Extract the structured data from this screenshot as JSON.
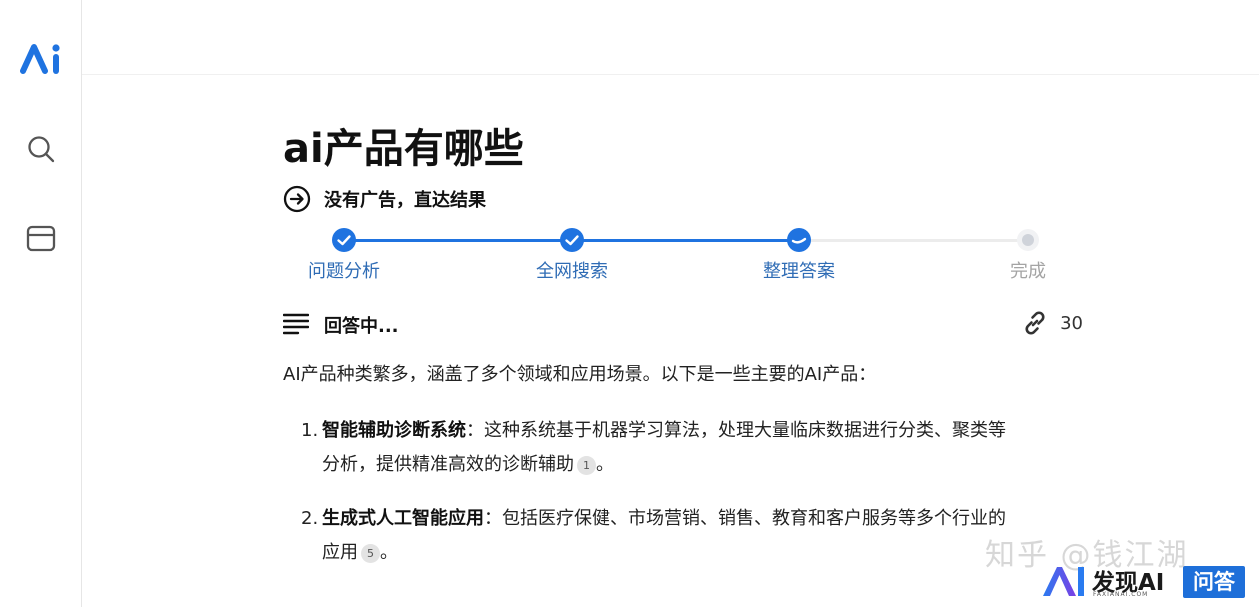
{
  "query": {
    "title": "ai产品有哪些"
  },
  "banner": {
    "text": "没有广告，直达结果"
  },
  "steps": [
    {
      "label": "问题分析",
      "state": "done"
    },
    {
      "label": "全网搜索",
      "state": "done"
    },
    {
      "label": "整理答案",
      "state": "active"
    },
    {
      "label": "完成",
      "state": "pending"
    }
  ],
  "answer": {
    "status": "回答中...",
    "source_count": "30",
    "intro": "AI产品种类繁多，涵盖了多个领域和应用场景。以下是一些主要的AI产品：",
    "items": [
      {
        "number": "1.",
        "heading": "智能辅助诊断系统",
        "text": "：这种系统基于机器学习算法，处理大量临床数据进行分类、聚类等",
        "text_line2": "分析，提供精准高效的诊断辅助",
        "citation": "1",
        "end": "。"
      },
      {
        "number": "2.",
        "heading": "生成式人工智能应用",
        "text": "：包括医疗保健、市场营销、销售、教育和客户服务等多个行业的",
        "text_line2": "应用",
        "citation": "5",
        "end": "。"
      }
    ]
  },
  "watermark": {
    "zhihu": "知乎 @钱江湖",
    "brand_name": "发现AI",
    "brand_domain": "FAXIANAI.COM",
    "brand_badge": "问答"
  },
  "colors": {
    "accent": "#1f73e0",
    "step_label": "#2f6cb5",
    "pending": "#cfd3da"
  },
  "icons": {
    "logo": "ai-logo-icon",
    "search": "search-icon",
    "window": "window-icon",
    "banner": "arrow-right-circle-icon",
    "status": "text-lines-icon",
    "sources": "link-icon"
  }
}
